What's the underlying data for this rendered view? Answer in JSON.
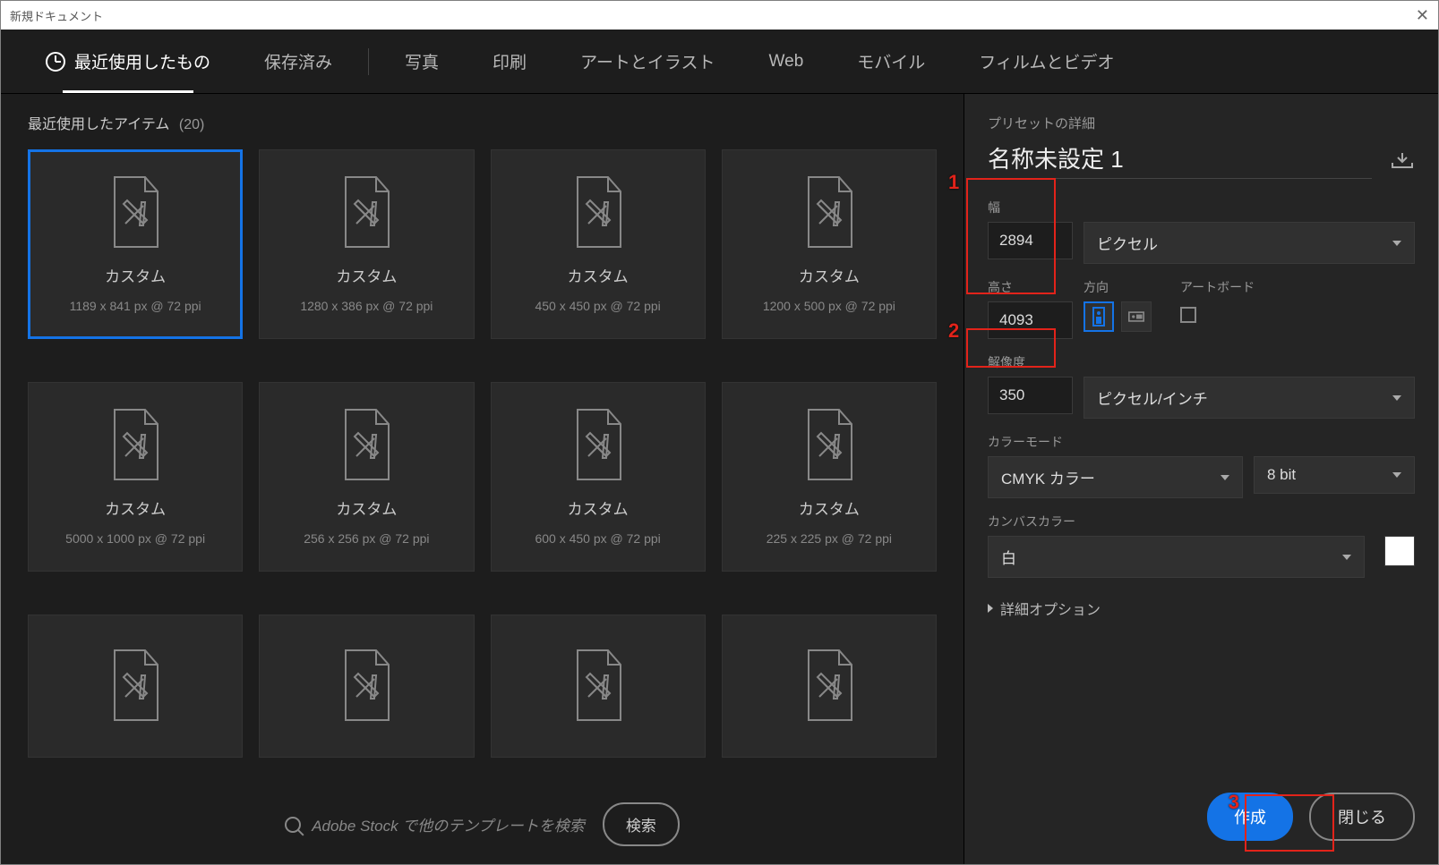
{
  "window_title": "新規ドキュメント",
  "tabs": {
    "recent": "最近使用したもの",
    "saved": "保存済み",
    "photo": "写真",
    "print": "印刷",
    "art": "アートとイラスト",
    "web": "Web",
    "mobile": "モバイル",
    "film": "フィルムとビデオ"
  },
  "section": {
    "label": "最近使用したアイテム",
    "count": "(20)"
  },
  "cards": [
    {
      "label": "カスタム",
      "meta": "1189 x 841 px @ 72 ppi"
    },
    {
      "label": "カスタム",
      "meta": "1280 x 386 px @ 72 ppi"
    },
    {
      "label": "カスタム",
      "meta": "450 x 450 px @ 72 ppi"
    },
    {
      "label": "カスタム",
      "meta": "1200 x 500 px @ 72 ppi"
    },
    {
      "label": "カスタム",
      "meta": "5000 x 1000 px @ 72 ppi"
    },
    {
      "label": "カスタム",
      "meta": "256 x 256 px @ 72 ppi"
    },
    {
      "label": "カスタム",
      "meta": "600 x 450 px @ 72 ppi"
    },
    {
      "label": "カスタム",
      "meta": "225 x 225 px @ 72 ppi"
    },
    {
      "label": "",
      "meta": ""
    },
    {
      "label": "",
      "meta": ""
    },
    {
      "label": "",
      "meta": ""
    },
    {
      "label": "",
      "meta": ""
    }
  ],
  "search": {
    "placeholder": "Adobe Stock で他のテンプレートを検索",
    "button": "検索"
  },
  "details": {
    "header": "プリセットの詳細",
    "name": "名称未設定 1",
    "width_label": "幅",
    "width_value": "2894",
    "unit_label": "ピクセル",
    "height_label": "高さ",
    "height_value": "4093",
    "orientation_label": "方向",
    "artboard_label": "アートボード",
    "resolution_label": "解像度",
    "resolution_value": "350",
    "resolution_unit": "ピクセル/インチ",
    "colormode_label": "カラーモード",
    "colormode_value": "CMYK カラー",
    "bitdepth_value": "8 bit",
    "canvas_label": "カンバスカラー",
    "canvas_value": "白",
    "advanced": "詳細オプション"
  },
  "buttons": {
    "create": "作成",
    "close": "閉じる"
  },
  "annotations": {
    "a1": "1",
    "a2": "2",
    "a3": "3"
  }
}
